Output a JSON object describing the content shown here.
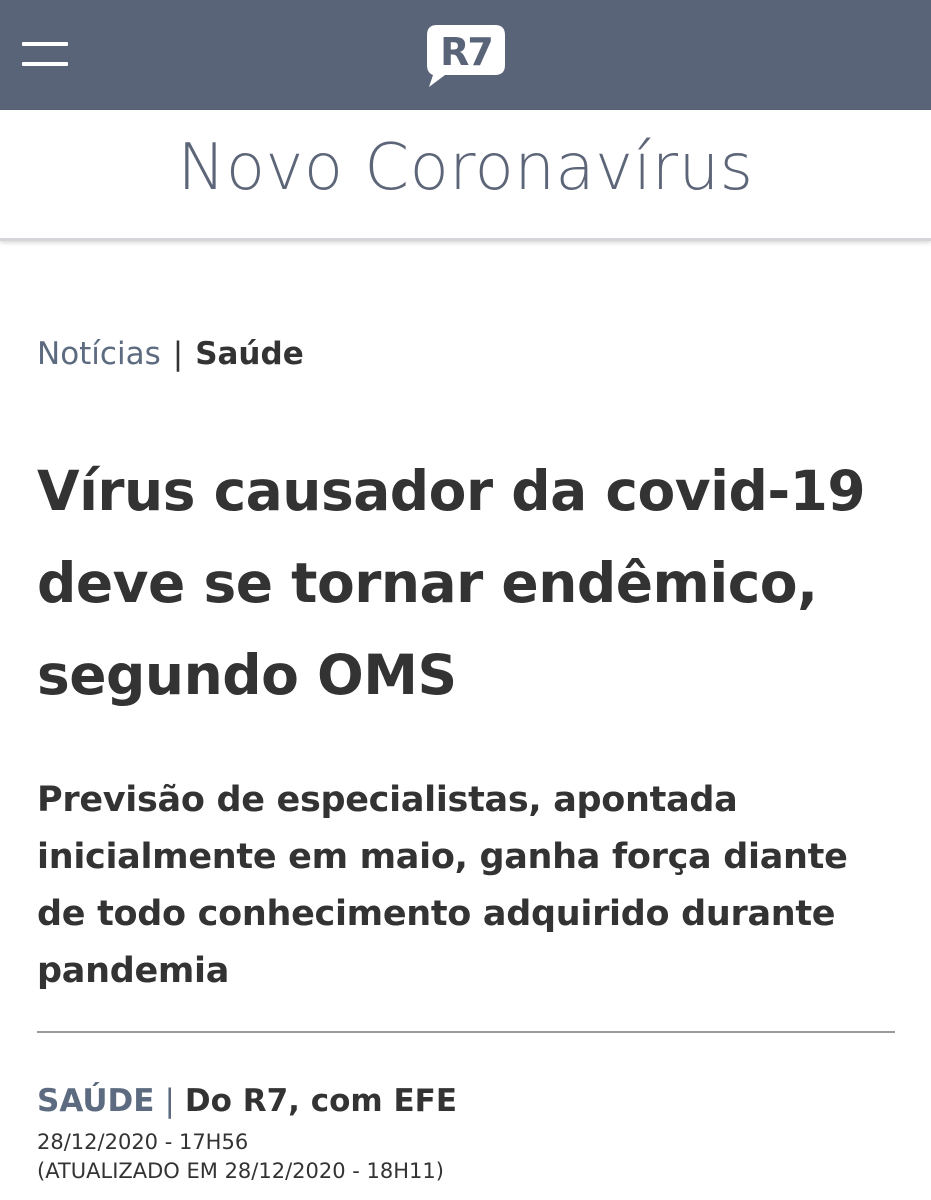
{
  "header": {
    "menu_icon": "hamburger-menu-icon",
    "logo_text": "R7",
    "background_color": "#5a6478"
  },
  "section": {
    "title": "Novo Coronavírus"
  },
  "breadcrumb": {
    "parent": "Notícias",
    "separator": "|",
    "current": "Saúde"
  },
  "article": {
    "headline": "Vírus causador da covid-19 deve se tornar endêmico, segundo OMS",
    "subheadline": "Previsão de especialistas, apontada inicialmente em maio, ganha força diante de todo conhecimento adquirido durante pandemia",
    "byline": {
      "section": "SAÚDE",
      "separator": "|",
      "source": "Do R7, com EFE"
    },
    "published": "28/12/2020 - 17H56",
    "updated": "(ATUALIZADO EM 28/12/2020 - 18H11)"
  }
}
